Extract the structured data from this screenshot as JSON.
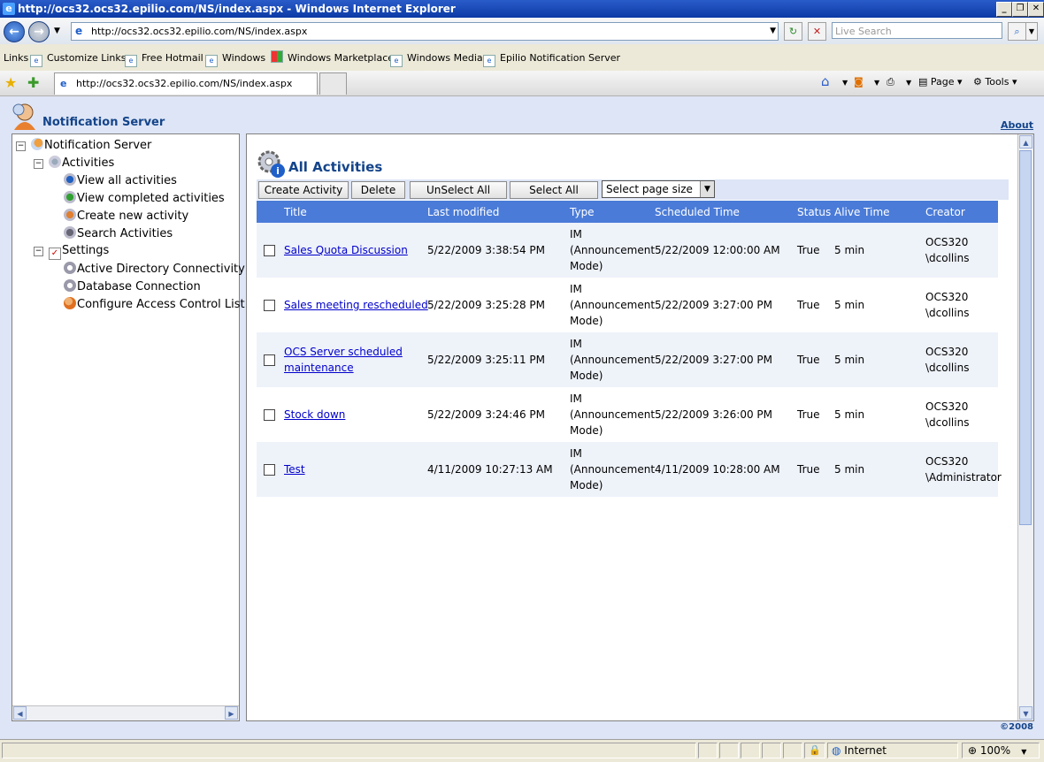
{
  "window": {
    "title": "http://ocs32.ocs32.epilio.com/NS/index.aspx - Windows Internet Explorer"
  },
  "browser": {
    "address": "http://ocs32.ocs32.epilio.com/NS/index.aspx",
    "search_placeholder": "Live Search",
    "links_label": "Links",
    "favorites": [
      "Customize Links",
      "Free Hotmail",
      "Windows",
      "Windows Marketplace",
      "Windows Media",
      "Epilio Notification Server"
    ],
    "tab_title": "http://ocs32.ocs32.epilio.com/NS/index.aspx",
    "page_menu": "Page",
    "tools_menu": "Tools"
  },
  "header": {
    "app_title": "Notification Server",
    "about": "About"
  },
  "tree": {
    "root": "Notification Server",
    "activities": "Activities",
    "activity_items": [
      "View all activities",
      "View completed activities",
      "Create new activity",
      "Search Activities"
    ],
    "settings": "Settings",
    "settings_items": [
      "Active Directory Connectivity",
      "Database Connection",
      "Configure Access Control List"
    ]
  },
  "main": {
    "title": "All Activities",
    "buttons": {
      "create": "Create Activity",
      "delete": "Delete",
      "unselect_all": "UnSelect All",
      "select_all": "Select All"
    },
    "page_size": "Select page size",
    "columns": [
      "Title",
      "Last modified",
      "Type",
      "Scheduled Time",
      "Status",
      "Alive Time",
      "Creator"
    ],
    "rows": [
      {
        "title1": "Sales Quota Discussion",
        "title2": "",
        "modified": "5/22/2009 3:38:54 PM",
        "type1": "IM",
        "type2": "(Announcement",
        "type3": "Mode)",
        "scheduled": "5/22/2009 12:00:00 AM",
        "status": "True",
        "alive": "5 min",
        "creator1": "OCS320",
        "creator2": "\\dcollins"
      },
      {
        "title1": "Sales meeting rescheduled",
        "title2": "",
        "modified": "5/22/2009 3:25:28 PM",
        "type1": "IM",
        "type2": "(Announcement",
        "type3": "Mode)",
        "scheduled": "5/22/2009 3:27:00 PM",
        "status": "True",
        "alive": "5 min",
        "creator1": "OCS320",
        "creator2": "\\dcollins"
      },
      {
        "title1": "OCS Server scheduled",
        "title2": "maintenance",
        "modified": "5/22/2009 3:25:11 PM",
        "type1": "IM",
        "type2": "(Announcement",
        "type3": "Mode)",
        "scheduled": "5/22/2009 3:27:00 PM",
        "status": "True",
        "alive": "5 min",
        "creator1": "OCS320",
        "creator2": "\\dcollins"
      },
      {
        "title1": "Stock down",
        "title2": "",
        "modified": "5/22/2009 3:24:46 PM",
        "type1": "IM",
        "type2": "(Announcement",
        "type3": "Mode)",
        "scheduled": "5/22/2009 3:26:00 PM",
        "status": "True",
        "alive": "5 min",
        "creator1": "OCS320",
        "creator2": "\\dcollins"
      },
      {
        "title1": "Test",
        "title2": "",
        "modified": "4/11/2009 10:27:13 AM",
        "type1": "IM",
        "type2": "(Announcement",
        "type3": "Mode)",
        "scheduled": "4/11/2009 10:28:00 AM",
        "status": "True",
        "alive": "5 min",
        "creator1": "OCS320",
        "creator2": "\\Administrator"
      }
    ],
    "copyright": "©2008"
  },
  "status_bar": {
    "zone": "Internet",
    "zoom": "100%"
  }
}
